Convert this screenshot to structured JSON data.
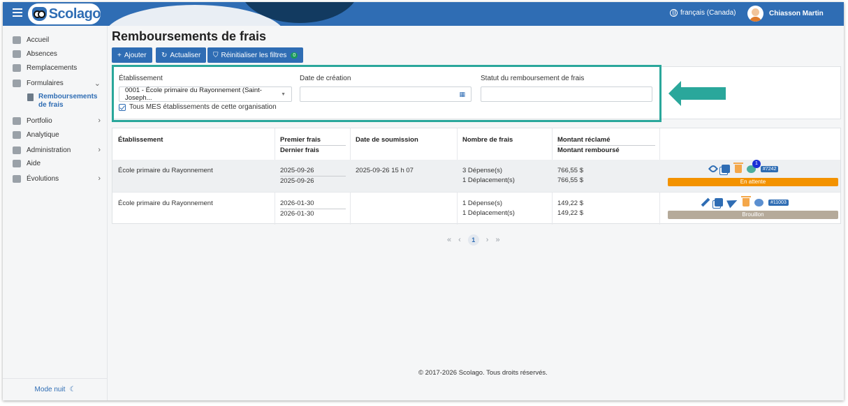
{
  "header": {
    "brand": "Scolago",
    "language": "français (Canada)",
    "user_name": "Chiasson Martin"
  },
  "sidebar": {
    "items": [
      {
        "label": "Accueil",
        "icon": "home-icon"
      },
      {
        "label": "Absences",
        "icon": "person-icon"
      },
      {
        "label": "Remplacements",
        "icon": "swap-icon"
      },
      {
        "label": "Formulaires",
        "icon": "form-icon"
      },
      {
        "label": "Portfolio",
        "icon": "trophy-icon"
      },
      {
        "label": "Analytique",
        "icon": "chart-icon"
      },
      {
        "label": "Administration",
        "icon": "gear-icon"
      },
      {
        "label": "Aide",
        "icon": "help-icon"
      },
      {
        "label": "Évolutions",
        "icon": "sprout-icon"
      }
    ],
    "sub_item": "Remboursements de frais",
    "mode_nuit": "Mode nuit"
  },
  "page": {
    "title": "Remboursements de frais"
  },
  "toolbar": {
    "add_label": "Ajouter",
    "refresh_label": "Actualiser",
    "reset_label": "Réinitialiser les filtres",
    "reset_count": "0"
  },
  "filters": {
    "etablissement_label": "Établissement",
    "etablissement_value": "0001 - École primaire du Rayonnement (Saint-Joseph...",
    "date_label": "Date de création",
    "date_value": "",
    "statut_label": "Statut du remboursement de frais",
    "statut_value": "",
    "checkbox_label": "Tous MES établissements de cette organisation",
    "checkbox_checked": true
  },
  "table": {
    "headers": {
      "etablissement": "Établissement",
      "premier": "Premier frais",
      "dernier": "Dernier frais",
      "soumission": "Date de soumission",
      "nombre": "Nombre de frais",
      "reclame": "Montant réclamé",
      "rembourse": "Montant remboursé"
    },
    "rows": [
      {
        "etablissement": "École primaire du Rayonnement",
        "premier": "2025-09-26",
        "dernier": "2025-09-26",
        "soumission": "2025-09-26 15 h 07",
        "depenses": "3 Dépense(s)",
        "deplacements": "1 Déplacement(s)",
        "reclame": "766,55 $",
        "rembourse": "766,55 $",
        "ref": "#7242",
        "notif": "1",
        "status": "En attente",
        "status_color": "#f39200"
      },
      {
        "etablissement": "École primaire du Rayonnement",
        "premier": "2026-01-30",
        "dernier": "2026-01-30",
        "soumission": "",
        "depenses": "1 Dépense(s)",
        "deplacements": "1 Déplacement(s)",
        "reclame": "149,22 $",
        "rembourse": "149,22 $",
        "ref": "#11003",
        "status": "Brouillon",
        "status_color": "#b5aa9a"
      }
    ]
  },
  "pagination": {
    "first": "«",
    "prev": "‹",
    "current": "1",
    "next": "›",
    "last": "»"
  },
  "footer": "© 2017-2026 Scolago. Tous droits réservés.",
  "colors": {
    "primary": "#2f6db4",
    "highlight": "#2aa79b",
    "pending": "#f39200",
    "draft": "#b5aa9a"
  }
}
